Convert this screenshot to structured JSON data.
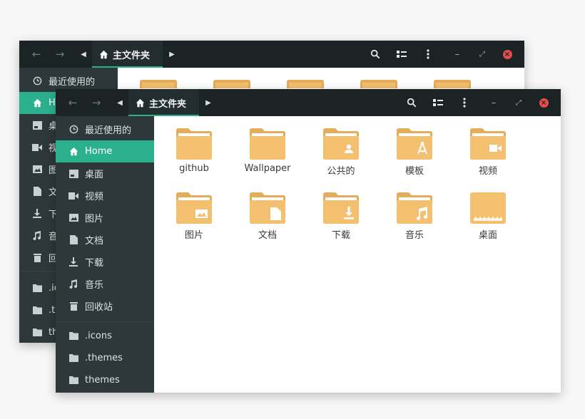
{
  "back_window": {
    "tab": {
      "label": "主文件夹"
    },
    "sidebar": {
      "items": [
        {
          "label": "最近使用的",
          "icon": "clock-icon"
        },
        {
          "label": "H",
          "icon": "home-icon"
        },
        {
          "label": "桌",
          "icon": "desktop-icon"
        },
        {
          "label": "视",
          "icon": "video-icon"
        },
        {
          "label": "图",
          "icon": "image-icon"
        },
        {
          "label": "文",
          "icon": "document-icon"
        },
        {
          "label": "下",
          "icon": "download-icon"
        },
        {
          "label": "音",
          "icon": "music-icon"
        },
        {
          "label": "回",
          "icon": "trash-icon"
        },
        {
          "label": ".ic",
          "icon": "folder-icon"
        },
        {
          "label": ".th",
          "icon": "folder-icon"
        },
        {
          "label": "th",
          "icon": "folder-icon"
        }
      ]
    }
  },
  "front_window": {
    "tab": {
      "label": "主文件夹"
    },
    "sidebar": {
      "items": [
        {
          "label": "最近使用的",
          "icon": "clock-icon"
        },
        {
          "label": "Home",
          "icon": "home-icon",
          "active": true
        },
        {
          "label": "桌面",
          "icon": "desktop-icon"
        },
        {
          "label": "视频",
          "icon": "video-icon"
        },
        {
          "label": "图片",
          "icon": "image-icon"
        },
        {
          "label": "文档",
          "icon": "document-icon"
        },
        {
          "label": "下载",
          "icon": "download-icon"
        },
        {
          "label": "音乐",
          "icon": "music-icon"
        },
        {
          "label": "回收站",
          "icon": "trash-icon"
        },
        {
          "label": ".icons",
          "icon": "folder-icon"
        },
        {
          "label": ".themes",
          "icon": "folder-icon"
        },
        {
          "label": "themes",
          "icon": "folder-icon"
        }
      ]
    },
    "files": [
      {
        "label": "github",
        "emblem": "none"
      },
      {
        "label": "Wallpaper",
        "emblem": "none"
      },
      {
        "label": "公共的",
        "emblem": "person"
      },
      {
        "label": "模板",
        "emblem": "compass"
      },
      {
        "label": "视频",
        "emblem": "video"
      },
      {
        "label": "图片",
        "emblem": "image"
      },
      {
        "label": "文档",
        "emblem": "document"
      },
      {
        "label": "下载",
        "emblem": "download"
      },
      {
        "label": "音乐",
        "emblem": "music"
      },
      {
        "label": "桌面",
        "emblem": "desktop"
      }
    ]
  },
  "colors": {
    "accent": "#2bb08e",
    "headerbar": "#1b2325",
    "sidebar": "#2e3739",
    "folder": "#f3c070",
    "folder_dark": "#e5ad5a",
    "close": "#e74c4c"
  }
}
